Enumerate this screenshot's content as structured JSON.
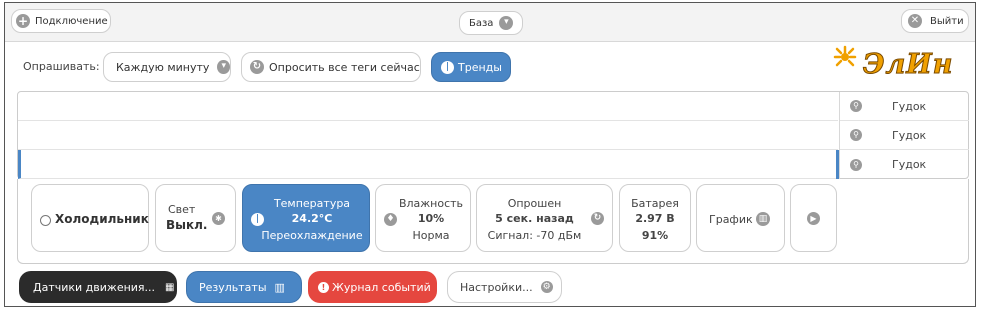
{
  "topbar": {
    "connection_label": "Подключение",
    "base_label": "База",
    "exit_label": "Выйти"
  },
  "toolbar": {
    "poll_label": "Опрашивать:",
    "poll_value": "Каждую минуту",
    "poll_all_label": "Опросить все теги сейчас",
    "trends_label": "Тренды"
  },
  "logo": {
    "text": "ЭлИн"
  },
  "table": {
    "rows": [
      {
        "action": "Гудок"
      },
      {
        "action": "Гудок"
      },
      {
        "action": "Гудок"
      }
    ]
  },
  "cards": {
    "fridge": {
      "name": "Холодильник"
    },
    "light": {
      "title": "Свет",
      "value": "Выкл."
    },
    "temperature": {
      "title": "Температура",
      "value": "24.2°C",
      "status": "Переохлаждение"
    },
    "humidity": {
      "title": "Влажность",
      "value": "10%",
      "status": "Норма"
    },
    "polled": {
      "title": "Опрошен",
      "value": "5 сек. назад",
      "signal": "Сигнал: -70 дБм"
    },
    "battery": {
      "title": "Батарея",
      "value": "2.97 В",
      "percent": "91%"
    },
    "chart": {
      "label": "График"
    }
  },
  "bottom": {
    "motion_sensors": "Датчики движения...",
    "results": "Результаты",
    "event_log": "Журнал событий",
    "settings": "Настройки..."
  },
  "colors": {
    "accent_blue": "#4a86c5",
    "dark_button": "#2b2b2b",
    "danger_red": "#e5473f",
    "logo_orange": "#f0a000"
  }
}
